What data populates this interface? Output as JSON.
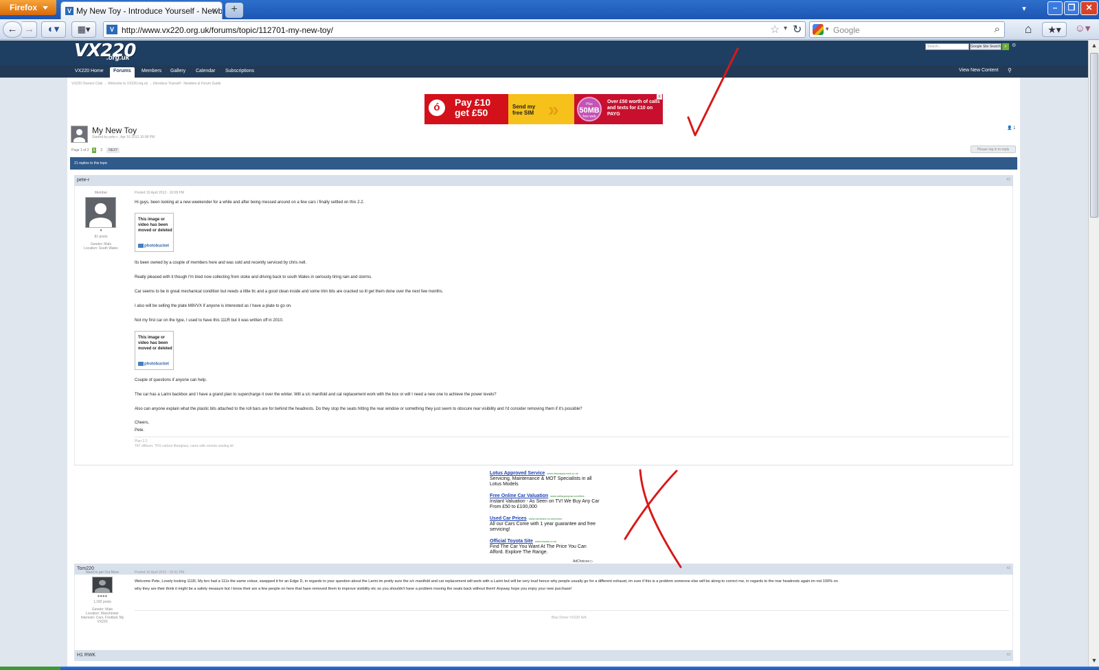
{
  "browser": {
    "app_button": "Firefox",
    "tab_title": "My New Toy - Introduce Yourself - Newbies ...",
    "new_tab": "+",
    "url": "http://www.vx220.org.uk/forums/topic/112701-my-new-toy/",
    "search_placeholder": "Google"
  },
  "site": {
    "logo": "VX220",
    "logo_sub": ".org.uk",
    "search_placeholder": "Search...",
    "search_scope": "Google Site Search",
    "nav": [
      "VX220 Home",
      "Forums",
      "Members",
      "Gallery",
      "Calendar",
      "Subscriptions"
    ],
    "active_nav": "Forums",
    "view_new_content": "View New Content"
  },
  "breadcrumb": "VX220 Owners Club  →  Welcome to VX220.org.uk  →  Introduce Yourself - Newbies & Forum Guide",
  "ad_banner": {
    "headline": "Pay £10 get £50",
    "sim": "Send my free SIM",
    "bubble_top": "Plus",
    "bubble_mid": "50MB",
    "bubble_bot": "free web",
    "offer": "Over £50 worth of calls and texts for £10 on PAYG"
  },
  "topic": {
    "title": "My New Toy",
    "started_by": "Started by pete-r , Apr 16 2012 10:08 PM",
    "follow_count": "1",
    "page_label": "Page 1 of 2",
    "pages": [
      "1",
      "2"
    ],
    "next": "NEXT",
    "login_to_reply": "Please log in to reply",
    "replies": "21 replies to this topic"
  },
  "posts": [
    {
      "author": "pete-r",
      "number": "#1",
      "rank": "Member",
      "post_count": "81 posts",
      "gender": "Gender: Male",
      "location": "Location: South Wales",
      "posted": "Posted 16 April 2012 - 10:08 PM",
      "paragraphs": [
        "Hi guys, been looking at a new weekender for a while and after being messed around on a few cars i finally settled on this 2.2.",
        "Its been owned by a couple of members here and was sold and recently serviced by chris nell.",
        "Really pleased with it though I'm tired now collecting from stoke and driving back to south Wales in seriously tiring rain and storms.",
        "Car seems to be in great mechanical condition but needs a little tlc and a good clean inside and some trim bits are cracked so ill get them done over the next few months.",
        "I also will be selling the plate M8VVX if anyone is interested as I have a plate to go on.",
        "Not my first car on the type, I used to have this 111R but it was written off in 2010.",
        "Couple of questions if anyone can help.",
        "The car has a Larini backbox and I have a grand plan to supercharge it over the winter. Will a s/c manifold and cat replacement work with the box or will I need a new one to achieve the power levels?",
        "Also can anyone explain what the plastic bits attached to the roll bars are for behind the headrests. Do they stop the seats hitting the rear window or something they just seem to obscure rear visibility and I'd consider removing them if it's possible?",
        "Cheers,",
        "Pete."
      ],
      "photobucket_msg": "This image or video has been moved or deleted",
      "photobucket_logo": "photobucket",
      "sig_1": "Plan 2.2",
      "sig_2": "TAT diffuser, TFG carbon fiberglass, cams with remote sealing kit"
    },
    {
      "author": "Tom220",
      "number": "#2",
      "rank": "Need to get Out More",
      "post_count": "1,182 posts",
      "gender": "Gender: Male",
      "location": "Location: Manchester",
      "interests": "Interests: Cars, Football, My VX220",
      "posted": "Posted 16 April 2012 - 10:31 PM",
      "text_1": "Welcome Pete, Lovely looking 111R, My bro had a 111s the same colour, swapped it for an Edge D, in regards to your question about the Larini im pretty sure the s/c manifold and cat replacement will work with a Larini but will be very loud hence why people usually go for a different exhaust, im sure if this is a problem someone else will be along to correct me, in regards to the rear headrests again im not 100% on",
      "text_2": "why they are their think it might be a safety measure but I know their are a few people on here that have removed them to improve visibility etc so you shouldn't have a problem moving the seats back without them! Anyway hope you enjoy your new purchase!",
      "sig": "Blue Driver VX220 N/A"
    },
    {
      "author": "H1 RWK",
      "number": "#3"
    }
  ],
  "text_ads": [
    {
      "title": "Lotus Approved Service",
      "url": "www.lotusapproved.co.uk",
      "desc": "Servicing, Maintenance & MOT Specialists in all Lotus Models"
    },
    {
      "title": "Free Online Car Valuation",
      "url": "www.webuyanycar.com/free",
      "desc": "Instant Valuation - As Seen on TV! We Buy Any Car From £50 to £100,000"
    },
    {
      "title": "Used Car Prices",
      "url": "www.usedcars.co.uk/prices",
      "desc": "All our Cars Come with 1 year guarantee and free servicing!"
    },
    {
      "title": "Official Toyota Site",
      "url": "www.toyota.co.uk",
      "desc": "Find The Car You Want At The Price You Can Afford. Explore The Range."
    }
  ],
  "adchoices": "AdChoices ▷",
  "annotations": {
    "mark_color": "#d81818"
  },
  "icons": [
    "back-arrow-icon",
    "forward-arrow-icon",
    "history-icon",
    "apps-icon",
    "bookmark-star-icon",
    "reload-icon",
    "search-icon",
    "home-icon",
    "bookmarks-icon",
    "persona-icon"
  ]
}
